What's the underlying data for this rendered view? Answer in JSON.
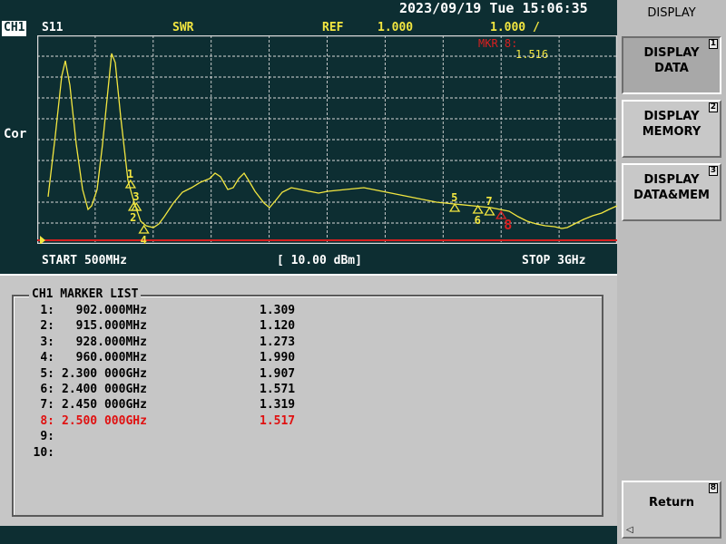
{
  "status_bar": {
    "datetime": "2023/09/19 Tue 15:06:35"
  },
  "trace_header": {
    "channel": "CH1",
    "parameter": "S11",
    "format": "SWR",
    "ref_label": "REF",
    "ref_value": "1.000",
    "scale": "1.000 /",
    "marker_readout": "MKR 8:",
    "marker_value": "1.516",
    "correction": "Cor"
  },
  "sweep": {
    "start": "START 500MHz",
    "power": "[ 10.00 dBm]",
    "stop": "STOP 3GHz"
  },
  "marker_list": {
    "title": "CH1 MARKER LIST",
    "rows": [
      {
        "index": "1:",
        "freq": "  902.000MHz",
        "value": "1.309"
      },
      {
        "index": "2:",
        "freq": "  915.000MHz",
        "value": "1.120"
      },
      {
        "index": "3:",
        "freq": "  928.000MHz",
        "value": "1.273"
      },
      {
        "index": "4:",
        "freq": "  960.000MHz",
        "value": "1.990"
      },
      {
        "index": "5:",
        "freq": "2.300 000GHz",
        "value": "1.907"
      },
      {
        "index": "6:",
        "freq": "2.400 000GHz",
        "value": "1.571"
      },
      {
        "index": "7:",
        "freq": "2.450 000GHz",
        "value": "1.319"
      },
      {
        "index": "8:",
        "freq": "2.500 000GHz",
        "value": "1.517"
      },
      {
        "index": "9:",
        "freq": "",
        "value": ""
      },
      {
        "index": "10:",
        "freq": "",
        "value": ""
      }
    ],
    "active_index": 7
  },
  "softkeys": {
    "menu_title": "DISPLAY",
    "keys": [
      {
        "label": "DISPLAY\nDATA",
        "number": "1"
      },
      {
        "label": "DISPLAY\nMEMORY",
        "number": "2"
      },
      {
        "label": "DISPLAY\nDATA&MEM",
        "number": "3"
      },
      {
        "label": "Return",
        "number": "8"
      }
    ],
    "selected": 0
  },
  "plot_markers": [
    {
      "label": "1",
      "fraction": 0.161,
      "swr": 1.309
    },
    {
      "label": "2",
      "fraction": 0.166,
      "swr": 1.12
    },
    {
      "label": "3",
      "fraction": 0.171,
      "swr": 1.273
    },
    {
      "label": "4",
      "fraction": 0.184,
      "swr": 1.99
    },
    {
      "label": "5",
      "fraction": 0.72,
      "swr": 1.907
    },
    {
      "label": "6",
      "fraction": 0.76,
      "swr": 1.571
    },
    {
      "label": "7",
      "fraction": 0.78,
      "swr": 1.319
    },
    {
      "label": "8",
      "fraction": 0.8,
      "swr": 1.517
    }
  ],
  "colors": {
    "background": "#0d2e32",
    "trace": "#f2e640",
    "reference": "#d82020",
    "active_marker": "#e01010"
  }
}
